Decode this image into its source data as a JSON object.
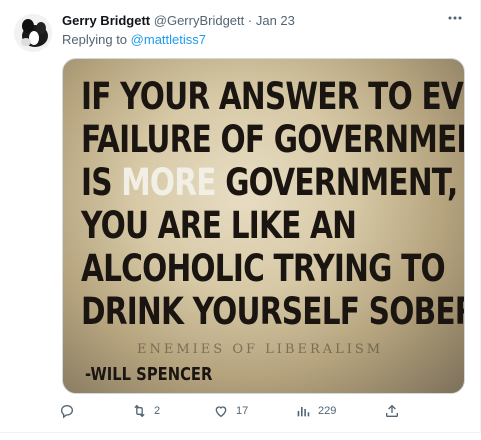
{
  "tweet": {
    "display_name": "Gerry Bridgett",
    "handle": "@GerryBridgett",
    "separator": "·",
    "date": "Jan 23",
    "replying_prefix": "Replying to",
    "replying_to": "@mattletiss7",
    "more_icon": "more-dots-icon"
  },
  "media": {
    "lines": [
      "IF YOUR ANSWER TO EVERY",
      "FAILURE OF GOVERNMENT",
      "GOVERNMENT,",
      "YOU ARE LIKE AN",
      "ALCOHOLIC TRYING TO",
      "DRINK YOURSELF SOBER."
    ],
    "line3_prefix": "IS ",
    "highlight_word": "MORE",
    "watermark": "ENEMIES OF LIBERALISM",
    "author": "-WILL SPENCER"
  },
  "actions": {
    "reply": {
      "icon": "reply-icon",
      "count": ""
    },
    "retweet": {
      "icon": "retweet-icon",
      "count": "2"
    },
    "like": {
      "icon": "heart-icon",
      "count": "17"
    },
    "views": {
      "icon": "views-icon",
      "count": "229"
    },
    "share": {
      "icon": "share-icon",
      "count": ""
    }
  },
  "colors": {
    "link": "#1d9bf0",
    "secondary_text": "#536471",
    "primary_text": "#0f1419"
  }
}
